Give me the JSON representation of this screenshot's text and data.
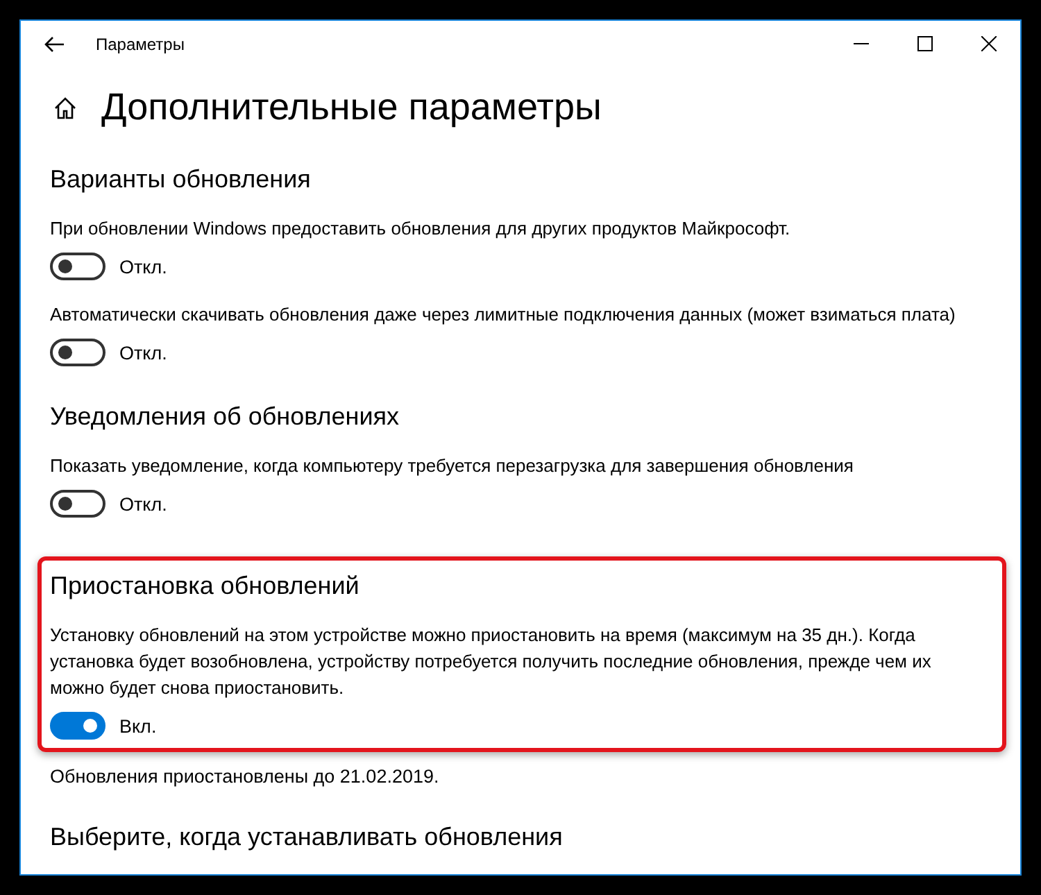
{
  "window": {
    "title": "Параметры"
  },
  "page_title": "Дополнительные параметры",
  "sections": [
    {
      "heading": "Варианты обновления",
      "highlighted": false,
      "options": [
        {
          "description": "При обновлении Windows предоставить обновления для других продуктов Майкрософт.",
          "on": false,
          "state_label": "Откл."
        },
        {
          "description": "Автоматически скачивать обновления даже через лимитные подключения данных (может взиматься плата)",
          "on": false,
          "state_label": "Откл."
        }
      ]
    },
    {
      "heading": "Уведомления об обновлениях",
      "highlighted": false,
      "options": [
        {
          "description": "Показать уведомление, когда компьютеру требуется перезагрузка для завершения обновления",
          "on": false,
          "state_label": "Откл."
        }
      ]
    },
    {
      "heading": "Приостановка обновлений",
      "highlighted": true,
      "options": [
        {
          "description": "Установку обновлений на этом устройстве можно приостановить на время (максимум на 35 дн.). Когда установка будет возобновлена, устройству потребуется получить последние обновления, прежде чем их можно будет снова приостановить.",
          "on": true,
          "state_label": "Вкл."
        }
      ],
      "note": "Обновления приостановлены до 21.02.2019."
    },
    {
      "heading": "Выберите, когда устанавливать обновления",
      "highlighted": false
    }
  ]
}
